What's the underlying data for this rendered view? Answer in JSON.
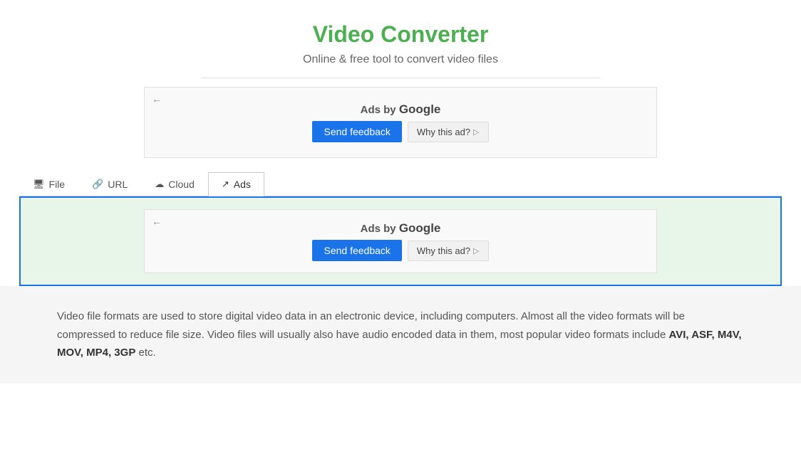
{
  "header": {
    "title": "Video Converter",
    "subtitle": "Online & free tool to convert video files"
  },
  "top_ad": {
    "back_arrow": "←",
    "ads_by_label": "Ads by ",
    "google_label": "Google",
    "send_feedback_label": "Send feedback",
    "why_this_ad_label": "Why this ad?",
    "why_arrow": "▷"
  },
  "tabs": [
    {
      "id": "file",
      "label": "File",
      "icon": "🖥"
    },
    {
      "id": "url",
      "label": "URL",
      "icon": "🔗"
    },
    {
      "id": "cloud",
      "label": "Cloud",
      "icon": "☁"
    },
    {
      "id": "ads",
      "label": "Ads",
      "icon": "↗"
    }
  ],
  "tab_ad": {
    "back_arrow": "←",
    "ads_by_label": "Ads by ",
    "google_label": "Google",
    "send_feedback_label": "Send feedback",
    "why_this_ad_label": "Why this ad?",
    "why_arrow": "▷"
  },
  "description": {
    "text_before_bold": "Video file formats are used to store digital video data in an electronic device, including computers. Almost all the video formats will be compressed to reduce file size. Video files will usually also have audio encoded data in them, most popular video formats include ",
    "bold_formats": "AVI, ASF, M4V, MOV, MP4, 3GP",
    "text_after_bold": " etc."
  }
}
